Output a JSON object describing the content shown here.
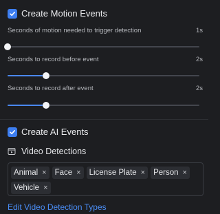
{
  "motion": {
    "checkbox_label": "Create Motion Events",
    "checked": true,
    "settings": [
      {
        "label": "Seconds of motion needed to trigger detection",
        "value": "1s",
        "level": 0.0
      },
      {
        "label": "Seconds to record before event",
        "value": "2s",
        "level": 0.2
      },
      {
        "label": "Seconds to record after event",
        "value": "2s",
        "level": 0.2
      }
    ]
  },
  "ai": {
    "checkbox_label": "Create AI Events",
    "checked": true,
    "video_detections_label": "Video Detections",
    "detection_types": [
      "Animal",
      "Face",
      "License Plate",
      "Person",
      "Vehicle"
    ],
    "remove_glyph": "×",
    "edit_link": "Edit Video Detection Types"
  },
  "icons": {
    "checkbox": "check-icon",
    "video_detections": "film-clip-icon",
    "chip_remove": "close-icon"
  },
  "colors": {
    "accent": "#3d7ef0",
    "link": "#4a8df5",
    "background": "#1d1e21"
  }
}
